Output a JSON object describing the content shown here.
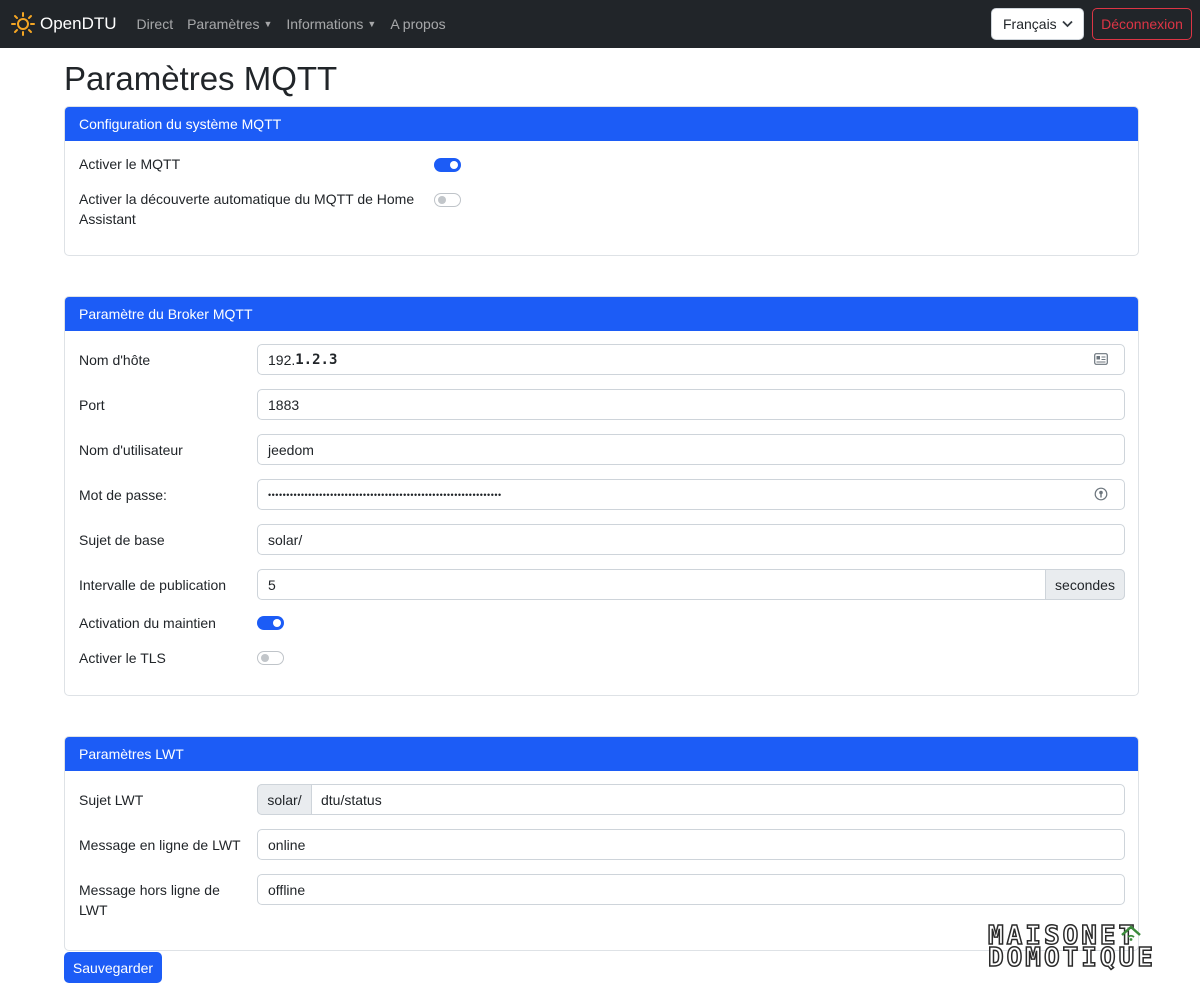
{
  "navbar": {
    "brand": "OpenDTU",
    "items": [
      {
        "label": "Direct",
        "dropdown": false
      },
      {
        "label": "Paramètres",
        "dropdown": true
      },
      {
        "label": "Informations",
        "dropdown": true
      },
      {
        "label": "A propos",
        "dropdown": false
      }
    ],
    "language": "Français",
    "logout": "Déconnexion"
  },
  "page": {
    "title": "Paramètres MQTT"
  },
  "mqtt_config": {
    "header": "Configuration du système MQTT",
    "enable_label": "Activer le MQTT",
    "enable_value": true,
    "ha_label_line1": "Activer la découverte automatique du MQTT de Home",
    "ha_label_line2": "Assistant",
    "ha_value": false
  },
  "broker": {
    "header": "Paramètre du Broker MQTT",
    "hostname_label": "Nom d'hôte",
    "hostname_prefix": "192.",
    "hostname_bold": "1.2.3",
    "port_label": "Port",
    "port_value": "1883",
    "username_label": "Nom d'utilisateur",
    "username_value": "jeedom",
    "password_label": "Mot de passe:",
    "password_value": "••••••••••••••••••••••••••••••••••••••••••••••••••••••••••••••••",
    "base_topic_label": "Sujet de base",
    "base_topic_value": "solar/",
    "interval_label": "Intervalle de publication",
    "interval_value": "5",
    "interval_unit": "secondes",
    "retain_label": "Activation du maintien",
    "retain_value": true,
    "tls_label": "Activer le TLS",
    "tls_value": false
  },
  "lwt": {
    "header": "Paramètres LWT",
    "topic_label": "Sujet LWT",
    "topic_prefix": "solar/",
    "topic_value": "dtu/status",
    "online_label": "Message en ligne de LWT",
    "online_value": "online",
    "offline_label_line1": "Message hors ligne de",
    "offline_label_line2": "LWT",
    "offline_value": "offline"
  },
  "actions": {
    "save": "Sauvegarder"
  },
  "watermark": {
    "line1": "MAISONET",
    "line2": "DOMOTIQUE"
  },
  "colors": {
    "primary": "#1c5cf6",
    "navbar": "#212529",
    "danger": "#dc3545"
  }
}
